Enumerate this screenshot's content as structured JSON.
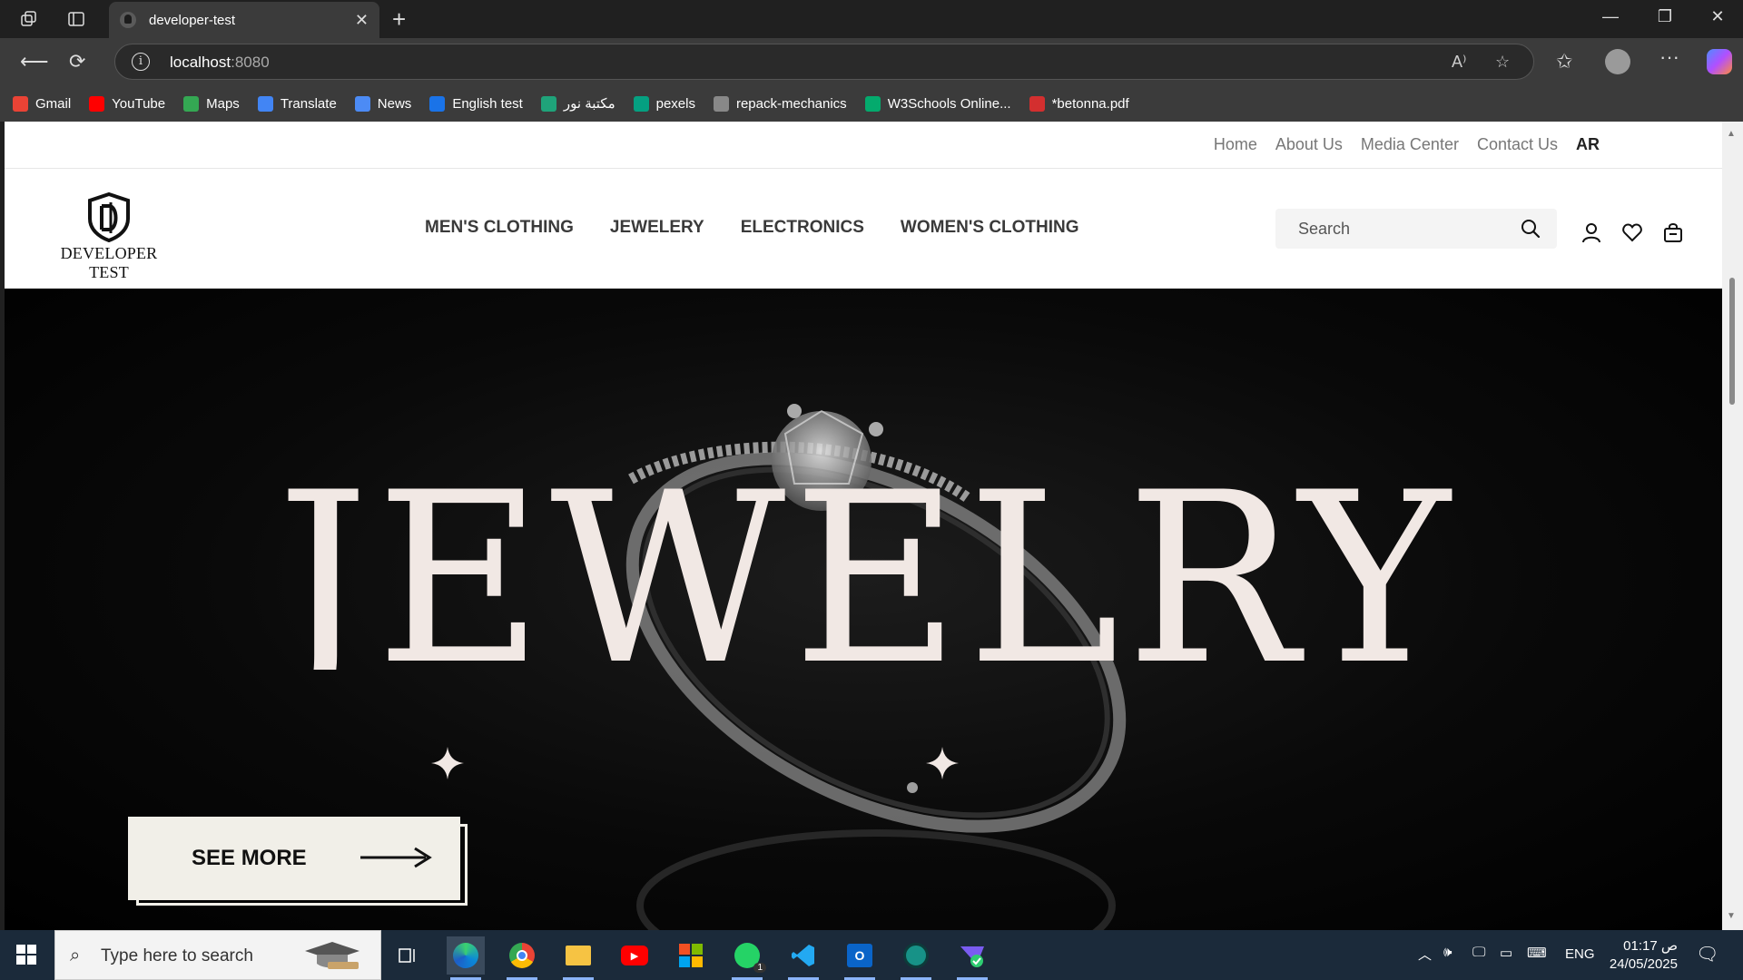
{
  "browser": {
    "tab_title": "developer-test",
    "url_host": "localhost",
    "url_port": ":8080",
    "bookmarks": [
      {
        "label": "Gmail",
        "color": "#ea4335"
      },
      {
        "label": "YouTube",
        "color": "#ff0000"
      },
      {
        "label": "Maps",
        "color": "#34a853"
      },
      {
        "label": "Translate",
        "color": "#4285f4"
      },
      {
        "label": "News",
        "color": "#4c8bf5"
      },
      {
        "label": "English test",
        "color": "#1a73e8"
      },
      {
        "label": "مكتبة نور",
        "color": "#1fa37a"
      },
      {
        "label": "pexels",
        "color": "#05a081"
      },
      {
        "label": "repack-mechanics",
        "color": "#888888"
      },
      {
        "label": "W3Schools Online...",
        "color": "#04aa6d"
      },
      {
        "label": "*betonna.pdf",
        "color": "#d32f2f"
      }
    ]
  },
  "site": {
    "top_links": [
      "Home",
      "About Us",
      "Media Center",
      "Contact Us"
    ],
    "lang_toggle": "AR",
    "logo_text": "DEVELOPER TEST",
    "categories": [
      "MEN'S CLOTHING",
      "JEWELERY",
      "ELECTRONICS",
      "WOMEN'S CLOTHING"
    ],
    "search_placeholder": "Search",
    "hero_title": "JEWELRY",
    "hero_button": "SEE MORE"
  },
  "taskbar": {
    "search_placeholder": "Type here to search",
    "lang": "ENG",
    "time": "01:17 ص",
    "date": "24/05/2025",
    "whatsapp_badge": "1"
  },
  "colors": {
    "hero_text": "#f1e8e4",
    "button_bg": "#f1efe8",
    "chrome_bg": "#202020",
    "taskbar_bg": "#1b2a3a"
  }
}
